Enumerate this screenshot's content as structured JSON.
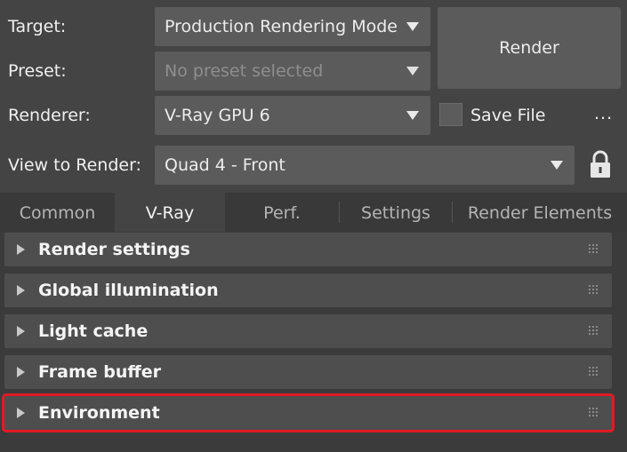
{
  "header": {
    "target_label": "Target:",
    "target_value": "Production Rendering Mode",
    "preset_label": "Preset:",
    "preset_value": "No preset selected",
    "renderer_label": "Renderer:",
    "renderer_value": "V-Ray GPU 6",
    "view_label": "View to Render:",
    "view_value": "Quad 4 - Front",
    "render_button": "Render",
    "save_file_label": "Save File",
    "save_file_checked": false,
    "more_button": "..."
  },
  "tabs": [
    {
      "label": "Common",
      "active": false
    },
    {
      "label": "V-Ray",
      "active": true
    },
    {
      "label": "Perf.",
      "active": false
    },
    {
      "label": "Settings",
      "active": false
    },
    {
      "label": "Render Elements",
      "active": false
    }
  ],
  "rollouts": [
    {
      "title": "Render settings",
      "highlighted": false
    },
    {
      "title": "Global illumination",
      "highlighted": false
    },
    {
      "title": "Light cache",
      "highlighted": false
    },
    {
      "title": "Frame buffer",
      "highlighted": false
    },
    {
      "title": "Environment",
      "highlighted": true
    }
  ],
  "colors": {
    "highlight": "#e01b24",
    "background": "#444444"
  }
}
